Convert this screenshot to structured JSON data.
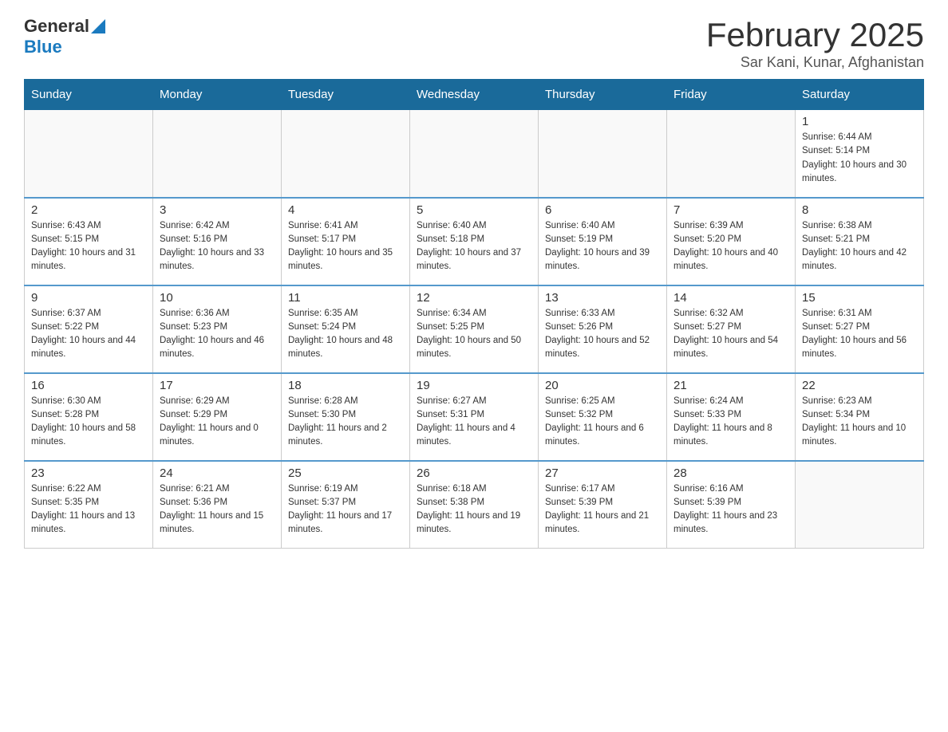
{
  "header": {
    "logo_general": "General",
    "logo_blue": "Blue",
    "month_title": "February 2025",
    "location": "Sar Kani, Kunar, Afghanistan"
  },
  "weekdays": [
    "Sunday",
    "Monday",
    "Tuesday",
    "Wednesday",
    "Thursday",
    "Friday",
    "Saturday"
  ],
  "weeks": [
    [
      {
        "day": "",
        "info": ""
      },
      {
        "day": "",
        "info": ""
      },
      {
        "day": "",
        "info": ""
      },
      {
        "day": "",
        "info": ""
      },
      {
        "day": "",
        "info": ""
      },
      {
        "day": "",
        "info": ""
      },
      {
        "day": "1",
        "info": "Sunrise: 6:44 AM\nSunset: 5:14 PM\nDaylight: 10 hours and 30 minutes."
      }
    ],
    [
      {
        "day": "2",
        "info": "Sunrise: 6:43 AM\nSunset: 5:15 PM\nDaylight: 10 hours and 31 minutes."
      },
      {
        "day": "3",
        "info": "Sunrise: 6:42 AM\nSunset: 5:16 PM\nDaylight: 10 hours and 33 minutes."
      },
      {
        "day": "4",
        "info": "Sunrise: 6:41 AM\nSunset: 5:17 PM\nDaylight: 10 hours and 35 minutes."
      },
      {
        "day": "5",
        "info": "Sunrise: 6:40 AM\nSunset: 5:18 PM\nDaylight: 10 hours and 37 minutes."
      },
      {
        "day": "6",
        "info": "Sunrise: 6:40 AM\nSunset: 5:19 PM\nDaylight: 10 hours and 39 minutes."
      },
      {
        "day": "7",
        "info": "Sunrise: 6:39 AM\nSunset: 5:20 PM\nDaylight: 10 hours and 40 minutes."
      },
      {
        "day": "8",
        "info": "Sunrise: 6:38 AM\nSunset: 5:21 PM\nDaylight: 10 hours and 42 minutes."
      }
    ],
    [
      {
        "day": "9",
        "info": "Sunrise: 6:37 AM\nSunset: 5:22 PM\nDaylight: 10 hours and 44 minutes."
      },
      {
        "day": "10",
        "info": "Sunrise: 6:36 AM\nSunset: 5:23 PM\nDaylight: 10 hours and 46 minutes."
      },
      {
        "day": "11",
        "info": "Sunrise: 6:35 AM\nSunset: 5:24 PM\nDaylight: 10 hours and 48 minutes."
      },
      {
        "day": "12",
        "info": "Sunrise: 6:34 AM\nSunset: 5:25 PM\nDaylight: 10 hours and 50 minutes."
      },
      {
        "day": "13",
        "info": "Sunrise: 6:33 AM\nSunset: 5:26 PM\nDaylight: 10 hours and 52 minutes."
      },
      {
        "day": "14",
        "info": "Sunrise: 6:32 AM\nSunset: 5:27 PM\nDaylight: 10 hours and 54 minutes."
      },
      {
        "day": "15",
        "info": "Sunrise: 6:31 AM\nSunset: 5:27 PM\nDaylight: 10 hours and 56 minutes."
      }
    ],
    [
      {
        "day": "16",
        "info": "Sunrise: 6:30 AM\nSunset: 5:28 PM\nDaylight: 10 hours and 58 minutes."
      },
      {
        "day": "17",
        "info": "Sunrise: 6:29 AM\nSunset: 5:29 PM\nDaylight: 11 hours and 0 minutes."
      },
      {
        "day": "18",
        "info": "Sunrise: 6:28 AM\nSunset: 5:30 PM\nDaylight: 11 hours and 2 minutes."
      },
      {
        "day": "19",
        "info": "Sunrise: 6:27 AM\nSunset: 5:31 PM\nDaylight: 11 hours and 4 minutes."
      },
      {
        "day": "20",
        "info": "Sunrise: 6:25 AM\nSunset: 5:32 PM\nDaylight: 11 hours and 6 minutes."
      },
      {
        "day": "21",
        "info": "Sunrise: 6:24 AM\nSunset: 5:33 PM\nDaylight: 11 hours and 8 minutes."
      },
      {
        "day": "22",
        "info": "Sunrise: 6:23 AM\nSunset: 5:34 PM\nDaylight: 11 hours and 10 minutes."
      }
    ],
    [
      {
        "day": "23",
        "info": "Sunrise: 6:22 AM\nSunset: 5:35 PM\nDaylight: 11 hours and 13 minutes."
      },
      {
        "day": "24",
        "info": "Sunrise: 6:21 AM\nSunset: 5:36 PM\nDaylight: 11 hours and 15 minutes."
      },
      {
        "day": "25",
        "info": "Sunrise: 6:19 AM\nSunset: 5:37 PM\nDaylight: 11 hours and 17 minutes."
      },
      {
        "day": "26",
        "info": "Sunrise: 6:18 AM\nSunset: 5:38 PM\nDaylight: 11 hours and 19 minutes."
      },
      {
        "day": "27",
        "info": "Sunrise: 6:17 AM\nSunset: 5:39 PM\nDaylight: 11 hours and 21 minutes."
      },
      {
        "day": "28",
        "info": "Sunrise: 6:16 AM\nSunset: 5:39 PM\nDaylight: 11 hours and 23 minutes."
      },
      {
        "day": "",
        "info": ""
      }
    ]
  ]
}
